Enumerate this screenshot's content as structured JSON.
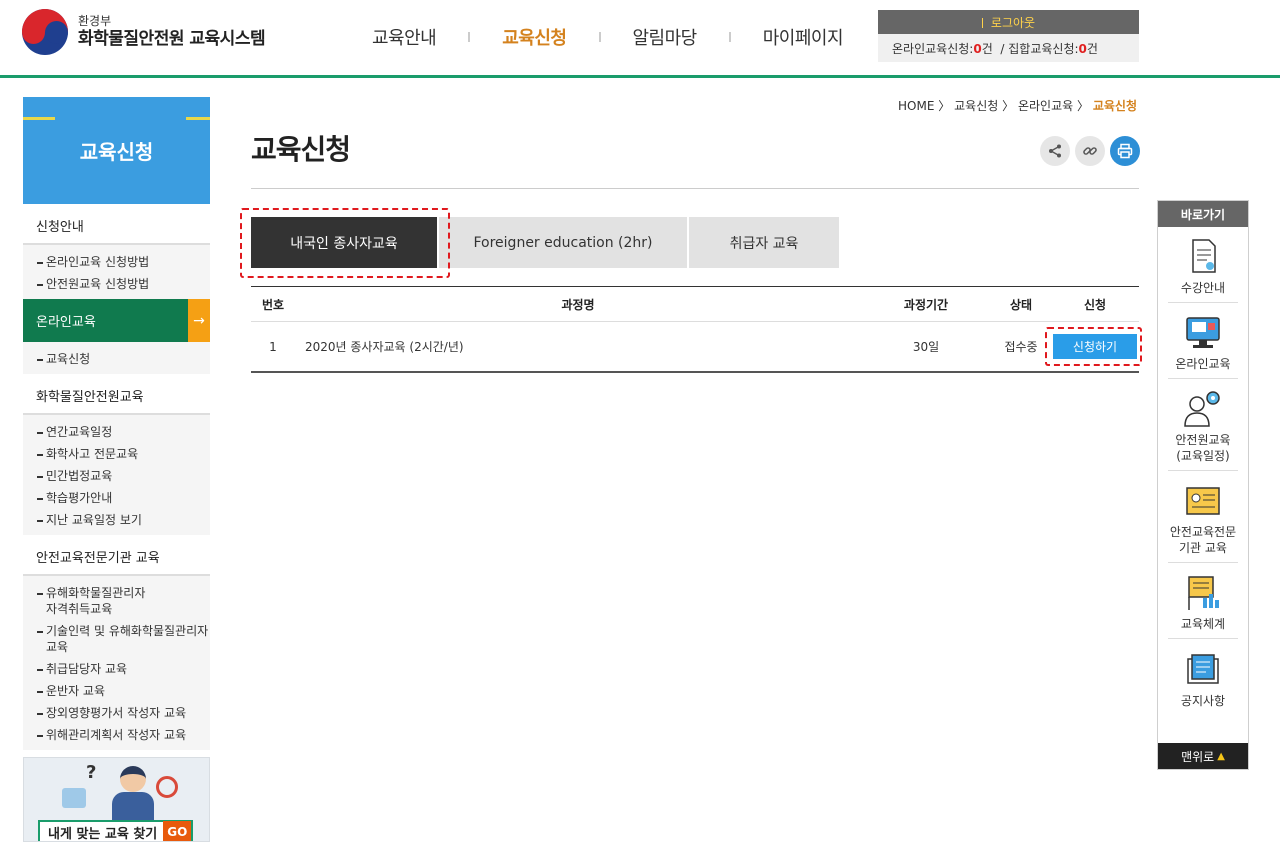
{
  "header": {
    "logo_sub": "환경부",
    "logo_main": "화학물질안전원 교육시스템",
    "nav": [
      "교육안내",
      "교육신청",
      "알림마당",
      "마이페이지"
    ],
    "logout": "로그아웃",
    "online_label": "온라인교육신청:",
    "online_count": "0",
    "group_label": "집합교육신청:",
    "group_count": "0",
    "count_unit": "건",
    "divider": "/"
  },
  "lnb": {
    "title": "교육신청",
    "group1": "신청안내",
    "group1_items": [
      "온라인교육 신청방법",
      "안전원교육 신청방법"
    ],
    "active": "온라인교육",
    "active_arrow": "→",
    "active_items": [
      "교육신청"
    ],
    "group2": "화학물질안전원교육",
    "group2_items": [
      "연간교육일정",
      "화학사고 전문교육",
      "민간법정교육",
      "학습평가안내",
      "지난 교육일정 보기"
    ],
    "group3": "안전교육전문기관 교육",
    "group3_items": [
      {
        "l1": "유해화학물질관리자",
        "l2": "자격취득교육"
      },
      {
        "l1": "기술인력 및 유해화학물질관리자",
        "l2": "교육"
      },
      {
        "l1": "취급담당자 교육",
        "l2": ""
      },
      {
        "l1": "운반자 교육",
        "l2": ""
      },
      {
        "l1": "장외영향평가서 작성자 교육",
        "l2": ""
      },
      {
        "l1": "위해관리계획서 작성자 교육",
        "l2": ""
      }
    ],
    "banner_q": "?",
    "banner_text": "내게 맞는 교육 찾기",
    "banner_go": "GO"
  },
  "breadcrumb": [
    "HOME",
    "교육신청",
    "온라인교육",
    "교육신청"
  ],
  "breadcrumb_sep": "〉",
  "page_title": "교육신청",
  "tabs": [
    "내국인 종사자교육",
    "Foreigner education (2hr)",
    "취급자 교육"
  ],
  "table": {
    "headers": [
      "번호",
      "과정명",
      "과정기간",
      "상태",
      "신청"
    ],
    "rows": [
      {
        "no": "1",
        "name": "2020년 종사자교육 (2시간/년)",
        "period": "30일",
        "status": "접수중",
        "apply": "신청하기"
      }
    ]
  },
  "quick": {
    "title": "바로가기",
    "items": [
      {
        "label1": "수강안내",
        "label2": "",
        "icon": "document-icon"
      },
      {
        "label1": "온라인교육",
        "label2": "",
        "icon": "monitor-icon"
      },
      {
        "label1": "안전원교육",
        "label2": "(교육일정)",
        "icon": "person-gear-icon"
      },
      {
        "label1": "안전교육전문",
        "label2": "기관 교육",
        "icon": "certificate-icon"
      },
      {
        "label1": "교육체계",
        "label2": "",
        "icon": "chart-board-icon"
      },
      {
        "label1": "공지사항",
        "label2": "",
        "icon": "notice-icon"
      }
    ],
    "top": "맨위로",
    "top_arrow": "▲"
  },
  "colors": {
    "accent_green": "#1a9c6b",
    "active_orange": "#d4821e",
    "lnb_blue": "#3b9de0",
    "apply_blue": "#2a9de8",
    "highlight_red": "#e0191e"
  }
}
